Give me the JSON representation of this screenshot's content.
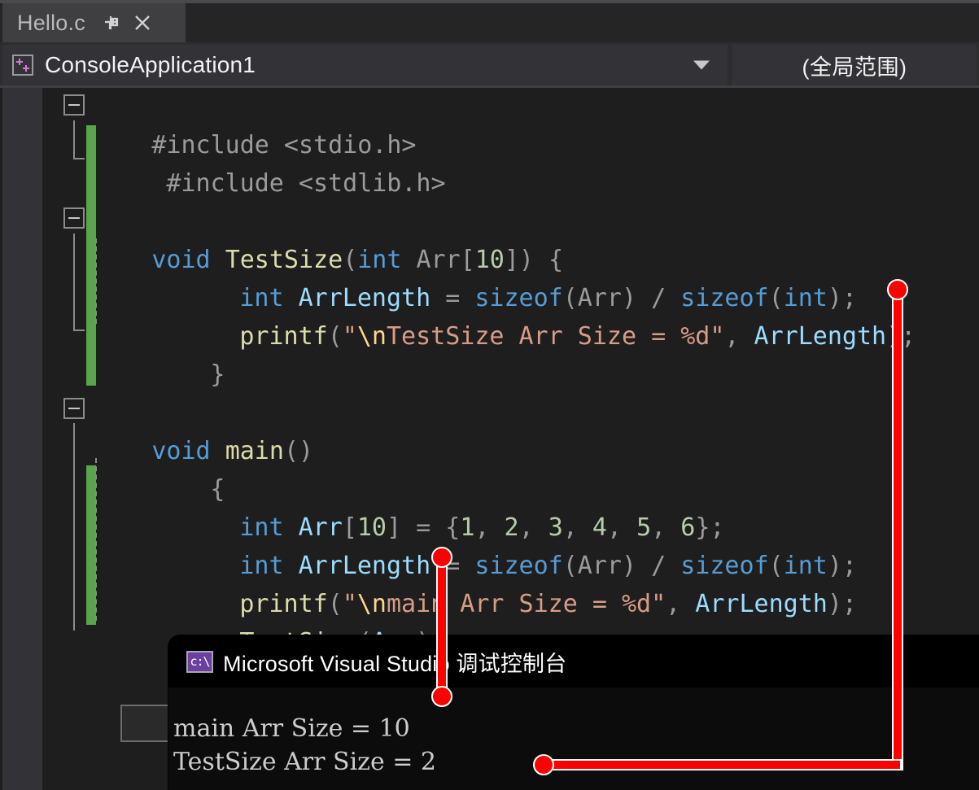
{
  "tab": {
    "filename": "Hello.c",
    "pin_icon": "pin-icon",
    "close_icon": "close-icon"
  },
  "navbar": {
    "project_icon": "cpp-project-icon",
    "project_name": "ConsoleApplication1",
    "caret_icon": "chevron-down-icon",
    "scope": "(全局范围)"
  },
  "editor": {
    "lines": [
      {
        "text": "#include <stdio.h>"
      },
      {
        "text": "#include <stdlib.h>"
      },
      {
        "text": ""
      },
      {
        "text": "void TestSize(int Arr[10]) {"
      },
      {
        "text": "    int ArrLength = sizeof(Arr) / sizeof(int);"
      },
      {
        "text": "    printf(\"\\nTestSize Arr Size = %d\", ArrLength);"
      },
      {
        "text": "}"
      },
      {
        "text": ""
      },
      {
        "text": "void main()"
      },
      {
        "text": "{"
      },
      {
        "text": "    int Arr[10] = {1, 2, 3, 4, 5, 6};"
      },
      {
        "text": "    int ArrLength = sizeof(Arr) / sizeof(int);"
      },
      {
        "text": "    printf(\"\\nmain Arr Size = %d\", ArrLength);"
      },
      {
        "text": "    TestSize(Arr);"
      },
      {
        "text": "}"
      }
    ],
    "colors": {
      "background": "#1e1e1e",
      "gutter": "#333337",
      "keyword": "#569cd6",
      "function": "#dcdcaa",
      "string": "#d69d85",
      "number": "#b5cea8",
      "variable": "#9cdcfe",
      "plain": "#9b9b9b",
      "change_bar": "#57a64a",
      "squiggle": "#6a9955"
    }
  },
  "console": {
    "icon": "console-cmd-icon",
    "title": "Microsoft Visual Studio 调试控制台",
    "output": [
      "main Arr Size = 10",
      "TestSize Arr Size = 2"
    ]
  },
  "annotations": {
    "color": "#ff0000",
    "items": [
      {
        "name": "annotation-main-arr-size",
        "kind": "vertical-connector"
      },
      {
        "name": "annotation-testsize-arr-size",
        "kind": "elbow-connector"
      }
    ]
  }
}
